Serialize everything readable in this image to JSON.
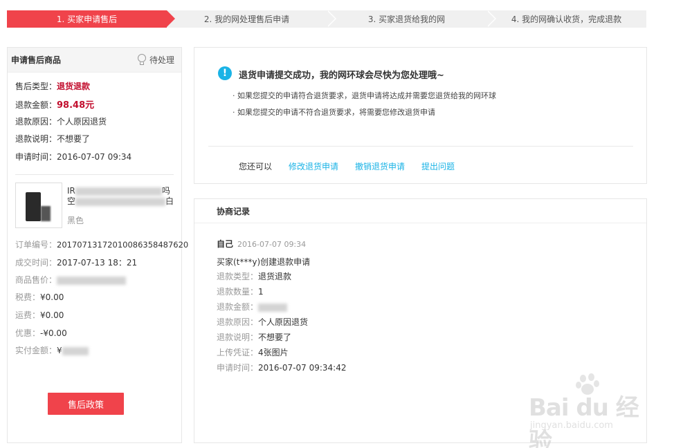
{
  "steps": [
    {
      "label": "1. 买家申请售后",
      "active": true
    },
    {
      "label": "2. 我的网处理售后申请",
      "active": false
    },
    {
      "label": "3. 买家退货给我的网",
      "active": false
    },
    {
      "label": "4. 我的网确认收货，完成退款",
      "active": false
    }
  ],
  "left": {
    "title": "申请售后商品",
    "status": "待处理",
    "after_sale_type_label": "售后类型：",
    "after_sale_type": "退货退款",
    "refund_amount_label": "退款金额：",
    "refund_amount": "98.48元",
    "refund_reason_label": "退款原因：",
    "refund_reason": "个人原因退货",
    "refund_note_label": "退款说明：",
    "refund_note": "不想要了",
    "apply_time_label": "申请时间：",
    "apply_time": "2016-07-07 09:34",
    "product_name_line1": "IR",
    "product_name_line1_end": "吗",
    "product_name_line2": "空",
    "product_name_line2_end": "白",
    "product_color": "黑色",
    "order_no_label": "订单编号：",
    "order_no": "20170713172010086358487620",
    "deal_time_label": "成交时间：",
    "deal_time": "2017-07-13 18：21",
    "price_label": "商品售价：",
    "tax_label": "税费：",
    "tax": "¥0.00",
    "shipping_label": "运费：",
    "shipping": "¥0.00",
    "discount_label": "优惠：",
    "discount": "-¥0.00",
    "paid_label": "实付金额：",
    "paid_prefix": "¥",
    "policy_button": "售后政策"
  },
  "notice": {
    "icon": "!",
    "title": "退货申请提交成功，我的网环球会尽快为您处理哦~",
    "bullet1": "· 如果您提交的申请符合退货要求，退货申请将达成并需要您退货给我的网环球",
    "bullet2": "· 如果您提交的申请不符合退货要求，将需要您修改退货申请",
    "actions_label": "您还可以",
    "action_modify": "修改退货申请",
    "action_cancel": "撤销退货申请",
    "action_question": "提出问题"
  },
  "records": {
    "title": "协商记录",
    "author": "自己",
    "time": "2016-07-07 09:34",
    "event": "买家(t***y)创建退款申请",
    "type_label": "退款类型：",
    "type": "退货退款",
    "qty_label": "退款数量：",
    "qty": "1",
    "amount_label": "退款金额：",
    "reason_label": "退款原因：",
    "reason": "个人原因退货",
    "note_label": "退款说明：",
    "note": "不想要了",
    "proof_label": "上传凭证：",
    "proof": "4张图片",
    "time_label": "申请时间：",
    "apply_time": "2016-07-07 09:34:42"
  },
  "watermark": {
    "brand": "Bai du 经验",
    "url": "jingyan.baidu.com"
  },
  "colors": {
    "accent_red": "#f0434b",
    "link_blue": "#1ab3e6",
    "price_red": "#c20f2e"
  }
}
